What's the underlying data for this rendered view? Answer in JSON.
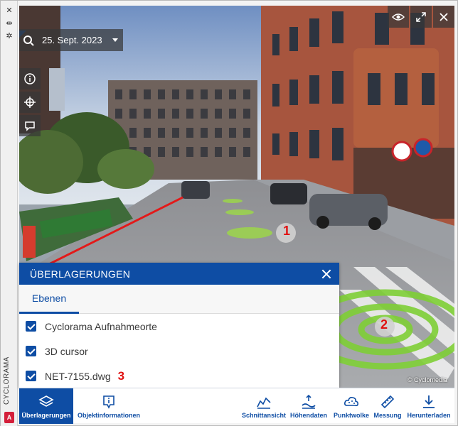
{
  "side_label": "CYCLORAMA",
  "side_logo": "A",
  "date": "25. Sept. 2023",
  "markers": [
    "1",
    "2"
  ],
  "copyright": "© Cyclomedia",
  "panel": {
    "title": "ÜBERLAGERUNGEN",
    "tab": "Ebenen",
    "layers": [
      {
        "label": "Cyclorama Aufnahmeorte",
        "checked": true
      },
      {
        "label": "3D cursor",
        "checked": true
      },
      {
        "label": "NET-7155.dwg",
        "checked": true,
        "marker": "3"
      }
    ]
  },
  "toolbar": {
    "left": [
      {
        "label": "Überlagerungen",
        "icon": "layers-icon",
        "active": true
      },
      {
        "label": "Objektinformationen",
        "icon": "info-pin-icon",
        "active": false
      }
    ],
    "right": [
      {
        "label": "Schnittansicht",
        "icon": "section-view-icon"
      },
      {
        "label": "Höhendaten",
        "icon": "height-data-icon"
      },
      {
        "label": "Punktwolke",
        "icon": "point-cloud-icon"
      },
      {
        "label": "Messung",
        "icon": "ruler-icon"
      },
      {
        "label": "Herunterladen",
        "icon": "download-icon"
      }
    ]
  },
  "colors": {
    "accent": "#0e4da4",
    "marker": "#e01212"
  }
}
